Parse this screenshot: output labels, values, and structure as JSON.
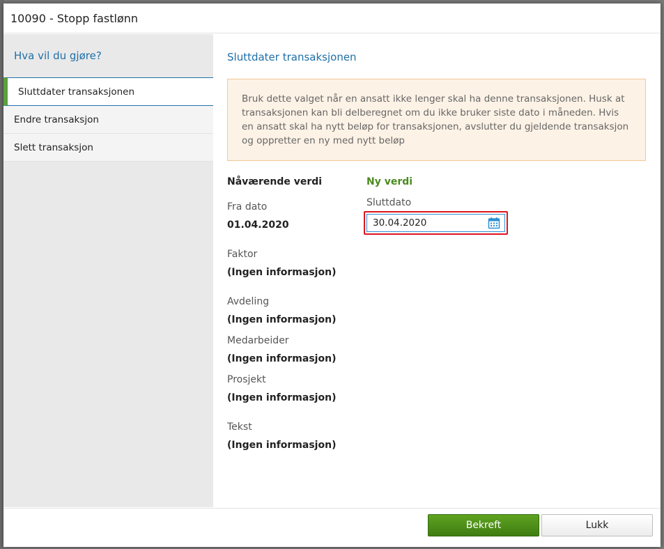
{
  "dialog": {
    "title": "10090 - Stopp fastlønn"
  },
  "sidebar": {
    "heading": "Hva vil du gjøre?",
    "items": [
      {
        "label": "Sluttdater transaksjonen",
        "active": true
      },
      {
        "label": "Endre transaksjon",
        "active": false
      },
      {
        "label": "Slett transaksjon",
        "active": false
      }
    ]
  },
  "main": {
    "title": "Sluttdater transaksjonen",
    "info": "Bruk dette valget når en ansatt ikke lenger skal ha denne transaksjonen. Husk at transaksjonen kan bli delberegnet om du ikke bruker siste dato i måneden. Hvis en ansatt skal ha nytt beløp for transaksjonen, avslutter du gjeldende transaksjon og oppretter en ny med nytt beløp",
    "current": {
      "heading": "Nåværende verdi",
      "fields": [
        {
          "label": "Fra dato",
          "value": "01.04.2020"
        },
        {
          "label": "Faktor",
          "value": "(Ingen informasjon)"
        },
        {
          "label": "Avdeling",
          "value": "(Ingen informasjon)"
        },
        {
          "label": "Medarbeider",
          "value": "(Ingen informasjon)"
        },
        {
          "label": "Prosjekt",
          "value": "(Ingen informasjon)"
        },
        {
          "label": "Tekst",
          "value": "(Ingen informasjon)"
        }
      ]
    },
    "new": {
      "heading": "Ny verdi",
      "end_date_label": "Sluttdato",
      "end_date_value": "30.04.2020",
      "calendar_icon": "calendar-icon"
    }
  },
  "footer": {
    "confirm_label": "Bekreft",
    "close_label": "Lukk"
  },
  "colors": {
    "accent_blue": "#1f6fa8",
    "accent_green": "#4b8a1e",
    "highlight_red": "#e0141e",
    "info_bg": "#fdf2e6"
  }
}
